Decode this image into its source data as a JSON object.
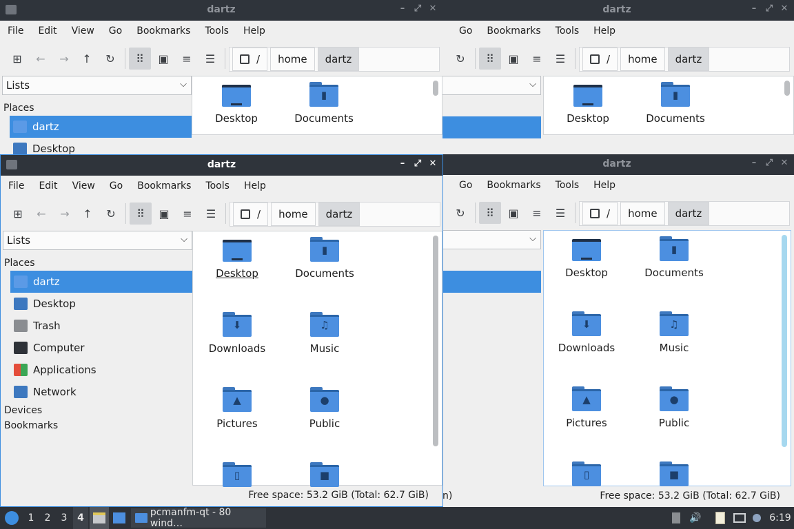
{
  "window": {
    "title": "dartz",
    "menu": [
      "File",
      "Edit",
      "View",
      "Go",
      "Bookmarks",
      "Tools",
      "Help"
    ],
    "path": [
      "/",
      "home",
      "dartz"
    ],
    "side_combo": "Lists",
    "places_heading": "Places",
    "places": [
      "dartz",
      "Desktop",
      "Trash",
      "Computer",
      "Applications",
      "Network"
    ],
    "devices_heading": "Devices",
    "bookmarks_heading": "Bookmarks",
    "files": [
      "Desktop",
      "Documents",
      "Downloads",
      "Music",
      "Pictures",
      "Public"
    ],
    "status": "Free space: 53.2 GiB (Total: 62.7 GiB)",
    "status_partial": "n)"
  },
  "taskbar": {
    "workspaces": [
      "1",
      "2",
      "3",
      "4"
    ],
    "task_label": "pcmanfm-qt - 80 wind…",
    "clock": "6:19"
  },
  "colors": {
    "accent": "#3d8ee0",
    "folder": "#4c8fe0",
    "titlebar": "#2f343b"
  },
  "icons": [
    "new-tab-icon",
    "back-icon",
    "forward-icon",
    "up-icon",
    "reload-icon",
    "icon-view-icon",
    "thumbnail-view-icon",
    "compact-view-icon",
    "detailed-list-icon",
    "drive-icon",
    "chevron-down-icon",
    "folder-icon",
    "volume-icon",
    "network-icon",
    "clipboard-icon",
    "notification-icon"
  ]
}
